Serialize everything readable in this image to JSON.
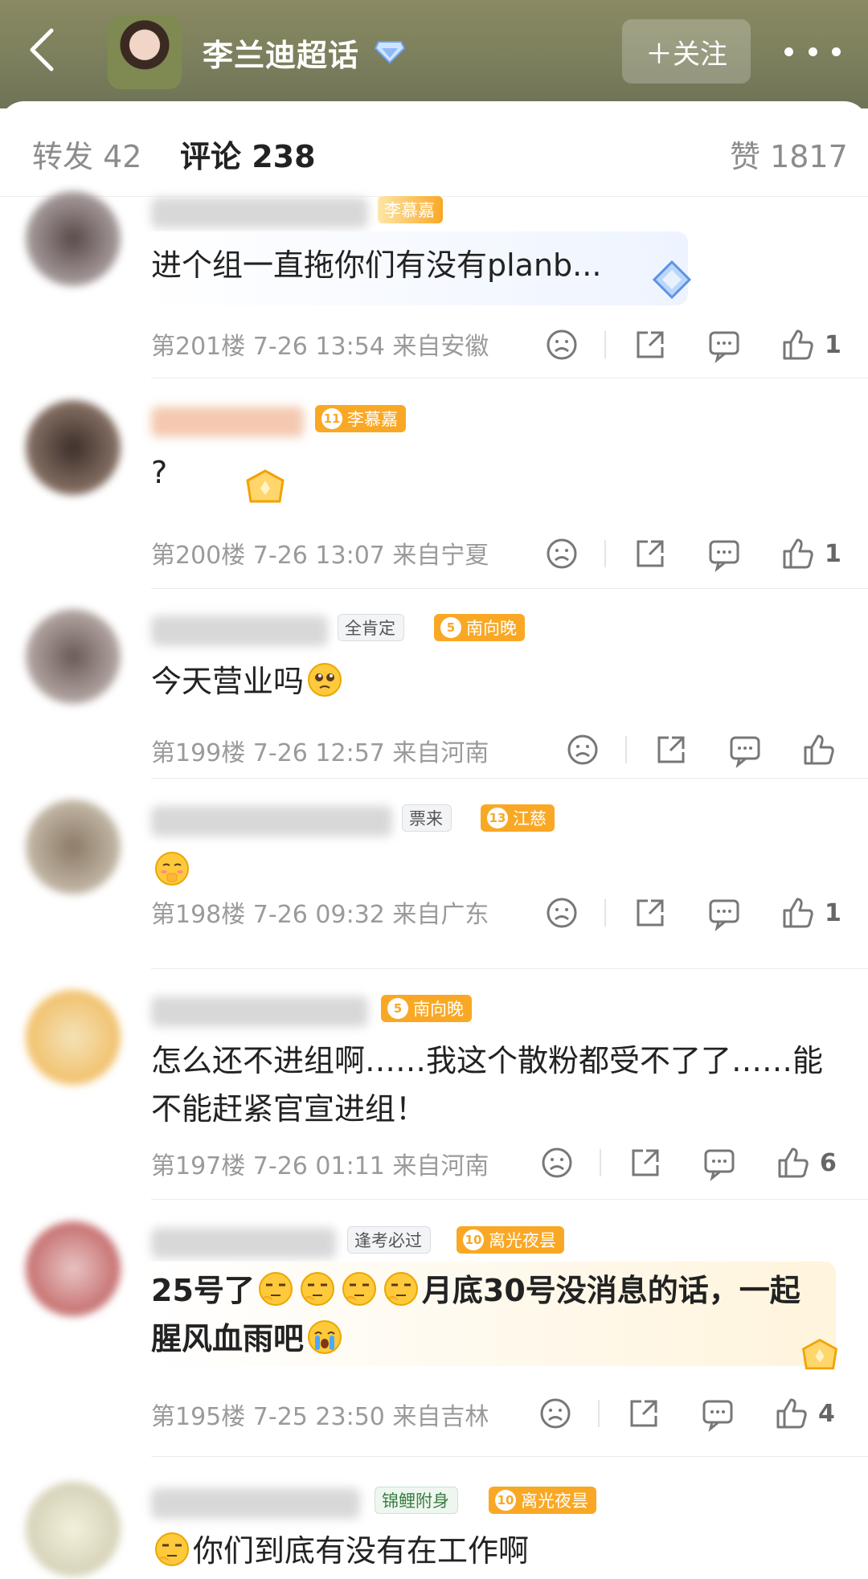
{
  "header": {
    "title": "李兰迪超话",
    "follow_label": "＋关注"
  },
  "tabs": {
    "repost": "转发 42",
    "comments": "评论 238",
    "likes": "赞 1817"
  },
  "colors": {
    "header_bg": "#7c7f5d",
    "fan_badge": "#f9a825",
    "text_meta": "#9a9a9a"
  },
  "comments": [
    {
      "fan_badge": {
        "level": "",
        "name": "李慕嘉"
      },
      "text": "进个组一直拖你们有没有planb...",
      "meta": "第201楼 7-26 13:54 来自安徽",
      "likes": "1"
    },
    {
      "fan_badge": {
        "level": "11",
        "name": "李慕嘉"
      },
      "text": "?",
      "meta": "第200楼 7-26 13:07 来自宁夏",
      "likes": "1"
    },
    {
      "title_badge": "全肯定",
      "fan_badge": {
        "level": "5",
        "name": "南向晚"
      },
      "text": "今天营业吗",
      "meta": "第199楼 7-26 12:57 来自河南",
      "likes": ""
    },
    {
      "title_badge": "票来",
      "fan_badge": {
        "level": "13",
        "name": "江慈"
      },
      "text": "",
      "meta": "第198楼 7-26 09:32 来自广东",
      "likes": "1"
    },
    {
      "fan_badge": {
        "level": "5",
        "name": "南向晚"
      },
      "text": "怎么还不进组啊……我这个散粉都受不了了……能不能赶紧官宣进组！",
      "meta": "第197楼 7-26 01:11 来自河南",
      "likes": "6"
    },
    {
      "title_badge": "逢考必过",
      "fan_badge": {
        "level": "10",
        "name": "离光夜昙"
      },
      "text_a": "25号了",
      "text_b": "月底30号没消息的话，一起腥风血雨吧",
      "meta": "第195楼 7-25 23:50 来自吉林",
      "likes": "4"
    },
    {
      "title_badge": "锦鲤附身",
      "fan_badge": {
        "level": "10",
        "name": "离光夜昙"
      },
      "text": "你们到底有没有在工作啊",
      "meta": "",
      "likes": ""
    }
  ]
}
